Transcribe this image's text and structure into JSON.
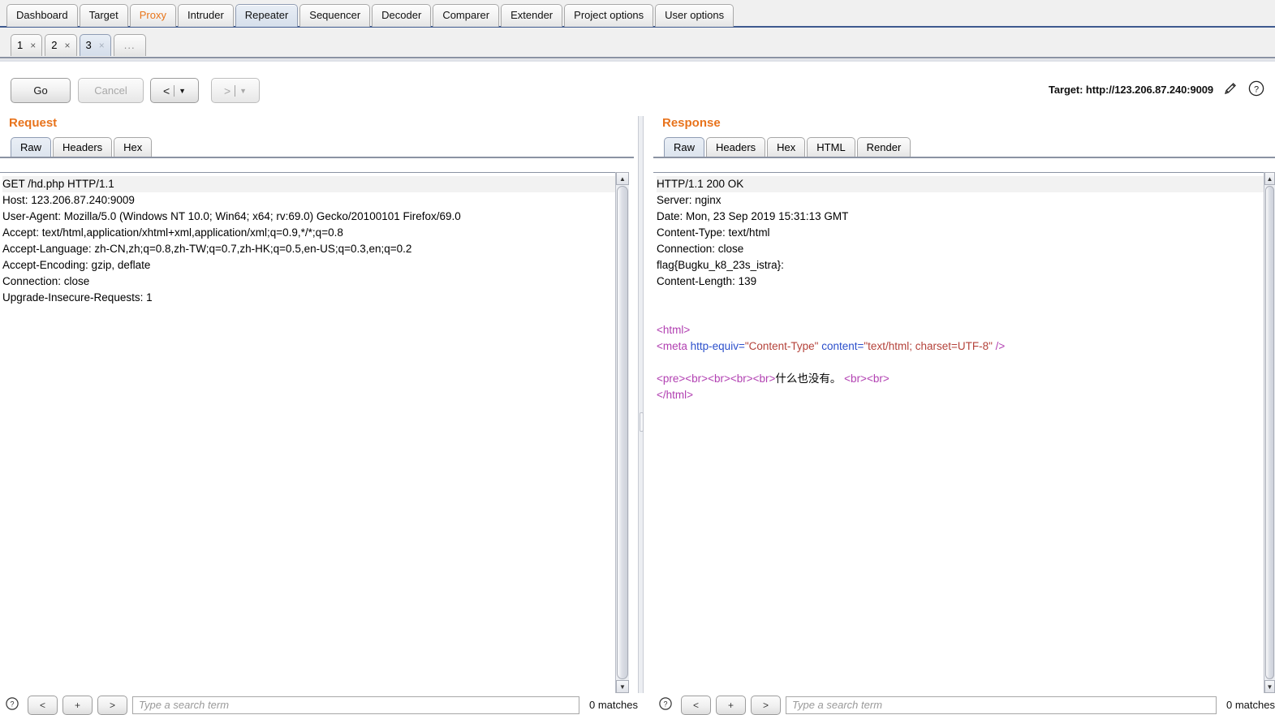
{
  "app": {
    "main_tabs": [
      {
        "label": "Dashboard",
        "state": "normal"
      },
      {
        "label": "Target",
        "state": "normal"
      },
      {
        "label": "Proxy",
        "state": "highlight"
      },
      {
        "label": "Intruder",
        "state": "normal"
      },
      {
        "label": "Repeater",
        "state": "active"
      },
      {
        "label": "Sequencer",
        "state": "normal"
      },
      {
        "label": "Decoder",
        "state": "normal"
      },
      {
        "label": "Comparer",
        "state": "normal"
      },
      {
        "label": "Extender",
        "state": "normal"
      },
      {
        "label": "Project options",
        "state": "normal"
      },
      {
        "label": "User options",
        "state": "normal"
      }
    ],
    "repeater_tabs": [
      {
        "label": "1",
        "close": "×",
        "state": "normal"
      },
      {
        "label": "2",
        "close": "×",
        "state": "normal"
      },
      {
        "label": "3",
        "close": "×",
        "state": "active"
      }
    ],
    "repeater_more_label": "...",
    "accent_color": "#e8731c",
    "active_tab_color": "#d6dfeb",
    "proxy_tab_color": "#e8751a"
  },
  "toolbar": {
    "go_label": "Go",
    "cancel_label": "Cancel",
    "back_label": "<",
    "back_caret": "▼",
    "forward_label": ">",
    "forward_caret": "▼",
    "target_label": "Target: http://123.206.87.240:9009",
    "edit_icon": "pencil-icon",
    "help_icon": "question-circle-icon"
  },
  "request": {
    "title": "Request",
    "tabs": [
      {
        "label": "Raw",
        "state": "active"
      },
      {
        "label": "Headers",
        "state": "normal"
      },
      {
        "label": "Hex",
        "state": "normal"
      }
    ],
    "lines": [
      "GET /hd.php HTTP/1.1",
      "Host: 123.206.87.240:9009",
      "User-Agent: Mozilla/5.0 (Windows NT 10.0; Win64; x64; rv:69.0) Gecko/20100101 Firefox/69.0",
      "Accept: text/html,application/xhtml+xml,application/xml;q=0.9,*/*;q=0.8",
      "Accept-Language: zh-CN,zh;q=0.8,zh-TW;q=0.7,zh-HK;q=0.5,en-US;q=0.3,en;q=0.2",
      "Accept-Encoding: gzip, deflate",
      "Connection: close",
      "Upgrade-Insecure-Requests: 1"
    ],
    "search": {
      "help_icon": "question-circle-icon",
      "prev_label": "<",
      "add_label": "+",
      "next_label": ">",
      "placeholder": "Type a search term",
      "matches": "0 matches"
    }
  },
  "response": {
    "title": "Response",
    "tabs": [
      {
        "label": "Raw",
        "state": "active"
      },
      {
        "label": "Headers",
        "state": "normal"
      },
      {
        "label": "Hex",
        "state": "normal"
      },
      {
        "label": "HTML",
        "state": "normal"
      },
      {
        "label": "Render",
        "state": "normal"
      }
    ],
    "header_lines": [
      "HTTP/1.1 200 OK",
      "Server: nginx",
      "Date: Mon, 23 Sep 2019 15:31:13 GMT",
      "Content-Type: text/html",
      "Connection: close",
      "flag{Bugku_k8_23s_istra}:",
      "Content-Length: 139"
    ],
    "body": {
      "line_html_open": "<html>",
      "meta_tag_open": "<meta ",
      "meta_attr1": "http-equiv=",
      "meta_val1": "\"Content-Type\"",
      "meta_attr2": " content=",
      "meta_val2": "\"text/html; charset=UTF-8\"",
      "meta_close": " />",
      "pre_tag": "<pre>",
      "br_tag": "<br>",
      "body_text": "什么也没有。 ",
      "line_html_close": "</html>"
    },
    "search": {
      "help_icon": "question-circle-icon",
      "prev_label": "<",
      "add_label": "+",
      "next_label": ">",
      "placeholder": "Type a search term",
      "matches": "0 matches"
    }
  },
  "scrollbars": {
    "up_arrow": "▲",
    "down_arrow": "▼"
  }
}
